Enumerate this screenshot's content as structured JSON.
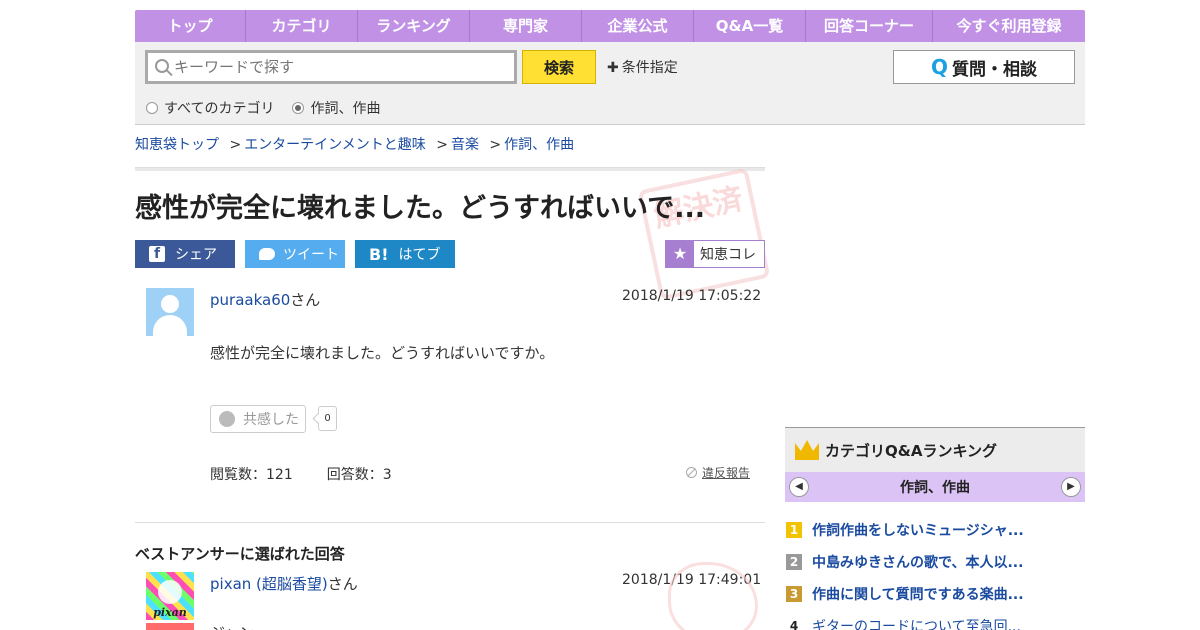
{
  "nav": [
    "トップ",
    "カテゴリ",
    "ランキング",
    "専門家",
    "企業公式",
    "Q&A一覧",
    "回答コーナー",
    "今すぐ利用登録"
  ],
  "search": {
    "placeholder": "キーワードで探す",
    "button": "検索",
    "condition": "条件指定",
    "radio_all": "すべてのカテゴリ",
    "radio_cat": "作詞、作曲",
    "ask_button": "質問・相談"
  },
  "breadcrumb": [
    "知恵袋トップ",
    "エンターテインメントと趣味",
    "音楽",
    "作詞、作曲"
  ],
  "stamp": "解決済",
  "question": {
    "title": "感性が完全に壊れました。どうすればいいで...",
    "user": "puraaka60",
    "user_suffix": "さん",
    "date": "2018/1/19  17:05:22",
    "body": "感性が完全に壊れました。どうすればいいですか。",
    "empathy_label": "共感した",
    "empathy_count": "0",
    "views": "閲覧数：121",
    "answers": "回答数：3",
    "report": "違反報告"
  },
  "share": {
    "facebook": "シェア",
    "twitter": "ツイート",
    "hatena": "はてブ",
    "collect": "知恵コレ",
    "hatena_icon": "B!",
    "facebook_icon": "f"
  },
  "best": {
    "heading": "ベストアンサーに選ばれた回答",
    "user": "pixan (超脳香望)",
    "user_suffix": "さん",
    "date": "2018/1/19  17:49:01",
    "avatar_text": "pixan",
    "peek": "ジャン..."
  },
  "ranking": {
    "title": "カテゴリQ&Aランキング",
    "category": "作詞、作曲",
    "items": [
      {
        "rank": "1",
        "title": "作詞作曲をしないミュージシャ..."
      },
      {
        "rank": "2",
        "title": "中島みゆきさんの歌で、本人以..."
      },
      {
        "rank": "3",
        "title": "作曲に関して質問ですある楽曲..."
      },
      {
        "rank": "4",
        "title": "ギターのコードについて至急回..."
      }
    ]
  }
}
